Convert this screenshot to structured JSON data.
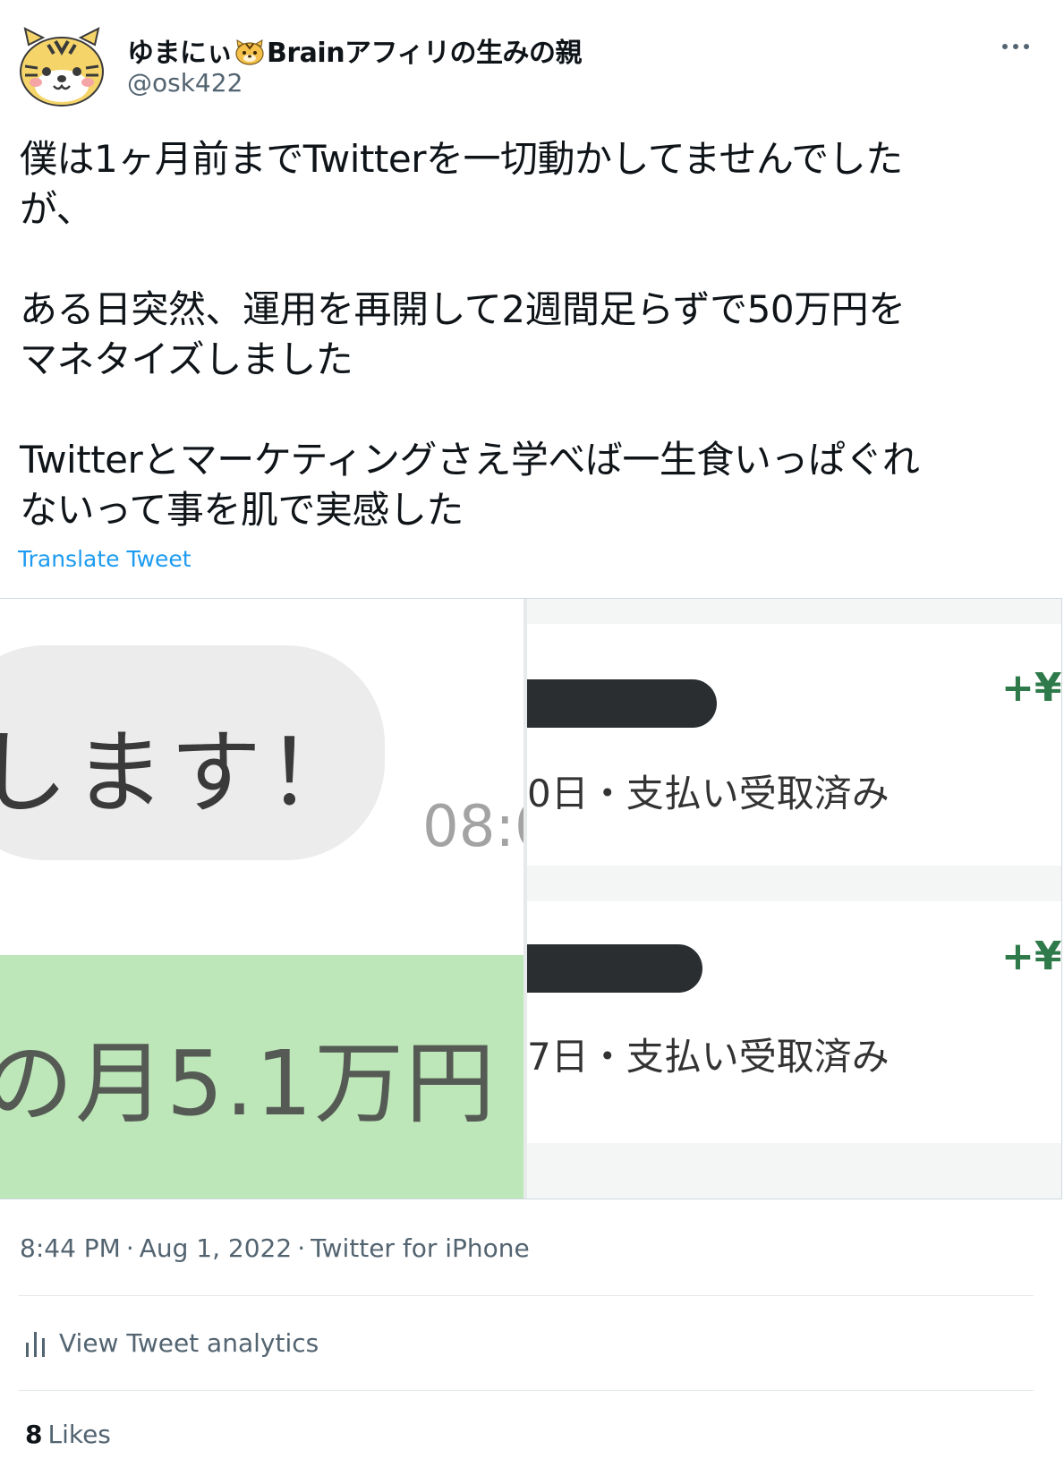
{
  "author": {
    "display_name_before": "ゆまにぃ",
    "emoji_icon": "tiger-face-icon",
    "display_name_after": "Brainアフィリの生みの親",
    "handle": "@osk422",
    "avatar_icon": "tiger-avatar-icon"
  },
  "more_icon": "more-horizontal-icon",
  "tweet": {
    "paragraphs": [
      "僕は1ヶ月前までTwitterを一切動かしてませんでした\nが、",
      "ある日突然、運用を再開して2週間足らずで50万円を\nマネタイズしました",
      "Twitterとマーケティングさえ学べば一生食いっぱぐれ\nないって事を肌で実感した"
    ],
    "translate_label": "Translate Tweet"
  },
  "media": {
    "left": {
      "bubble_text": "します！",
      "bubble_time": "08:0",
      "green_text": "の月5.1万円"
    },
    "right": {
      "cards": [
        {
          "amount": "+¥",
          "status": "0日・支払い受取済み"
        },
        {
          "amount": "+¥",
          "status": "7日・支払い受取済み"
        }
      ]
    }
  },
  "meta": {
    "time": "8:44 PM",
    "separator": "·",
    "date": "Aug 1, 2022",
    "source": "Twitter for iPhone"
  },
  "analytics": {
    "icon": "bar-chart-icon",
    "label": "View Tweet analytics"
  },
  "likes": {
    "count": "8",
    "label": "Likes"
  },
  "colors": {
    "link_blue": "#1d9bf0",
    "secondary_text": "#536471",
    "primary_text": "#0f1419",
    "chat_green": "#bde7b8",
    "amount_green": "#2f7a4a"
  }
}
